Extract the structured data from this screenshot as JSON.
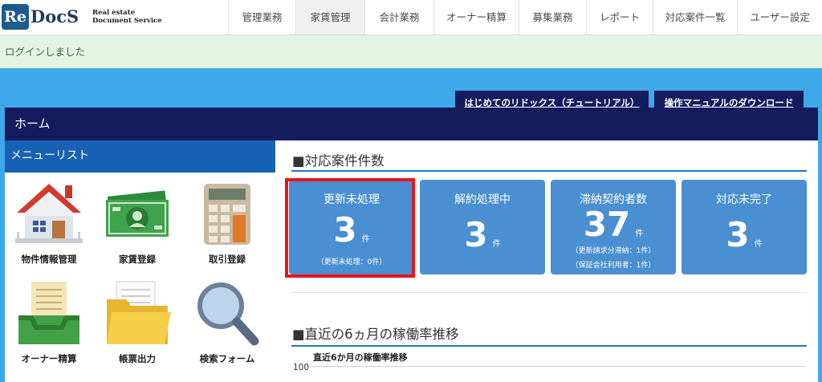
{
  "brand": {
    "logo_mark": "Re",
    "logo_rest": "DocS",
    "subtitle_line1": "Real estate",
    "subtitle_line2": "Document Service"
  },
  "nav": {
    "items": [
      {
        "label": "管理業務",
        "active": false
      },
      {
        "label": "家賃管理",
        "active": true
      },
      {
        "label": "会計業務",
        "active": false
      },
      {
        "label": "オーナー精算",
        "active": false
      },
      {
        "label": "募集業務",
        "active": false
      },
      {
        "label": "レポート",
        "active": false
      },
      {
        "label": "対応案件一覧",
        "active": false
      },
      {
        "label": "ユーザー設定",
        "active": false
      }
    ]
  },
  "login_message": "ログインしました",
  "top_tabs": {
    "tutorial": "はじめてのリドックス（チュートリアル）",
    "manual": "操作マニュアルのダウンロード"
  },
  "home_title": "ホーム",
  "menu": {
    "title": "メニューリスト",
    "items": [
      {
        "label": "物件情報管理",
        "icon": "house-icon"
      },
      {
        "label": "家賃登録",
        "icon": "banknote-icon"
      },
      {
        "label": "取引登録",
        "icon": "calculator-icon"
      },
      {
        "label": "オーナー精算",
        "icon": "inbox-tray-icon"
      },
      {
        "label": "帳票出力",
        "icon": "folder-icon"
      },
      {
        "label": "検索フォーム",
        "icon": "magnifier-icon"
      }
    ]
  },
  "cases": {
    "title": "■対応案件件数",
    "cards": [
      {
        "title": "更新未処理",
        "count": "3",
        "unit": "件",
        "notes": [
          "（更新未処理：0件）"
        ],
        "highlighted": true
      },
      {
        "title": "解約処理中",
        "count": "3",
        "unit": "件",
        "notes": [],
        "highlighted": false
      },
      {
        "title": "滞納契約者数",
        "count": "37",
        "unit": "件",
        "notes": [
          "（更新請求分滞納：1件）",
          "（保証会社利用者：1件）"
        ],
        "highlighted": false
      },
      {
        "title": "対応未完了",
        "count": "3",
        "unit": "件",
        "notes": [],
        "highlighted": false
      }
    ]
  },
  "occupancy": {
    "title": "■直近の6ヵ月の稼働率推移",
    "chart_title": "直近6か月の稼働率推移",
    "y_tick_top": "100"
  },
  "colors": {
    "navy": "#141c5e",
    "band_blue": "#3ea8ea",
    "menu_blue": "#1762b5",
    "card_blue": "#4a8fd2",
    "highlight_red": "#e8141c",
    "login_green_bg": "#e4f4e4"
  }
}
